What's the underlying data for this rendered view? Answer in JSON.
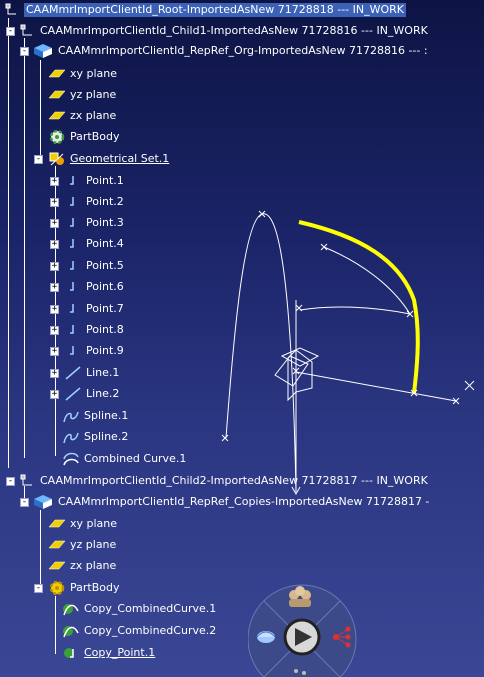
{
  "tree": {
    "root": {
      "label": "CAAMmrImportClientId_Root-ImportedAsNew 71728818 --- IN_WORK"
    },
    "child1": {
      "label": "CAAMmrImportClientId_Child1-ImportedAsNew 71728816 --- IN_WORK"
    },
    "repref_org": {
      "label": "CAAMmrImportClientId_RepRef_Org-ImportedAsNew 71728816 --- :"
    },
    "org_items": [
      {
        "label": "xy plane"
      },
      {
        "label": "yz plane"
      },
      {
        "label": "zx plane"
      },
      {
        "label": "PartBody"
      },
      {
        "label": "Geometrical Set.1"
      }
    ],
    "geoset_items": [
      {
        "label": "Point.1"
      },
      {
        "label": "Point.2"
      },
      {
        "label": "Point.3"
      },
      {
        "label": "Point.4"
      },
      {
        "label": "Point.5"
      },
      {
        "label": "Point.6"
      },
      {
        "label": "Point.7"
      },
      {
        "label": "Point.8"
      },
      {
        "label": "Point.9"
      },
      {
        "label": "Line.1"
      },
      {
        "label": "Line.2"
      },
      {
        "label": "Spline.1"
      },
      {
        "label": "Spline.2"
      },
      {
        "label": "Combined Curve.1"
      }
    ],
    "child2": {
      "label": "CAAMmrImportClientId_Child2-ImportedAsNew 71728817 --- IN_WORK"
    },
    "repref_copies": {
      "label": "CAAMmrImportClientId_RepRef_Copies-ImportedAsNew 71728817 -"
    },
    "copies_items": [
      {
        "label": "xy plane"
      },
      {
        "label": "yz plane"
      },
      {
        "label": "zx plane"
      },
      {
        "label": "PartBody"
      }
    ],
    "partbody2_items": [
      {
        "label": "Copy_CombinedCurve.1"
      },
      {
        "label": "Copy_CombinedCurve.2"
      },
      {
        "label": "Copy_Point.1"
      }
    ]
  },
  "colors": {
    "background_top": "#0d1444",
    "background_bottom": "#3a4794",
    "selection": "#3b62b7",
    "highlight_curve": "#ffff00",
    "plane_icon": "#f0d000"
  },
  "icons": {
    "product": "product-icon",
    "part": "part-icon",
    "plane": "plane-icon",
    "partbody": "partbody-gear-icon",
    "geoset": "geometrical-set-icon",
    "point": "point-icon",
    "line": "line-icon",
    "spline": "spline-icon",
    "combined_curve": "combined-curve-icon",
    "copy_curve": "copy-curve-icon",
    "copy_point": "copy-point-icon",
    "compass": "navigation-compass-icon"
  }
}
